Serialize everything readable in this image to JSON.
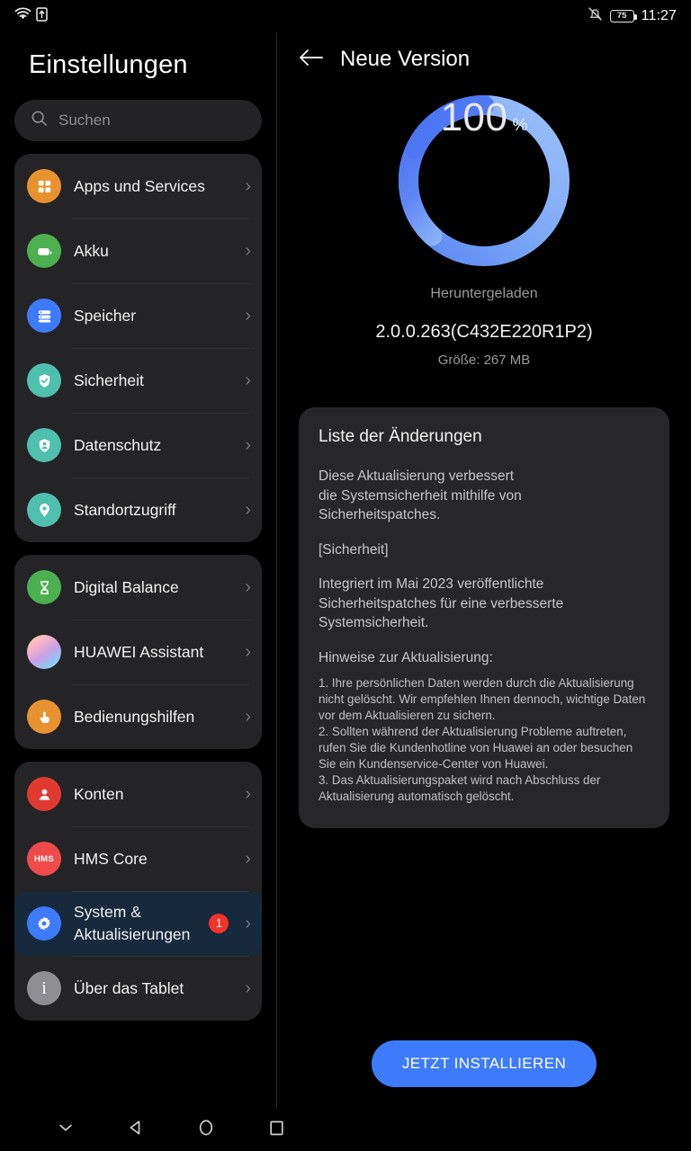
{
  "status_bar": {
    "wifi_icon": "wifi-icon",
    "vpn_icon": "vpn-upload-icon",
    "silent_icon": "bell-muted-icon",
    "battery_level": "75",
    "time": "11:27"
  },
  "sidebar": {
    "title": "Einstellungen",
    "search": {
      "placeholder": "Suchen",
      "icon": "search-icon"
    },
    "groups": [
      {
        "items": [
          {
            "label": "Apps und Services",
            "icon": "apps-grid-icon",
            "color": "#e8922f"
          },
          {
            "label": "Akku",
            "icon": "battery-icon",
            "color": "#4caf50"
          },
          {
            "label": "Speicher",
            "icon": "storage-stack-icon",
            "color": "#3d7bfb"
          },
          {
            "label": "Sicherheit",
            "icon": "shield-check-icon",
            "color": "#4fbfae"
          },
          {
            "label": "Datenschutz",
            "icon": "shield-person-icon",
            "color": "#4fbfae"
          },
          {
            "label": "Standortzugriff",
            "icon": "location-pin-icon",
            "color": "#4fbfae"
          }
        ]
      },
      {
        "items": [
          {
            "label": "Digital Balance",
            "icon": "hourglass-icon",
            "color": "#4caf50"
          },
          {
            "label": "HUAWEI Assistant",
            "icon": "assistant-orb-icon",
            "color": "#c9a0dc"
          },
          {
            "label": "Bedienungshilfen",
            "icon": "accessibility-tap-icon",
            "color": "#e8922f"
          }
        ]
      },
      {
        "items": [
          {
            "label": "Konten",
            "icon": "person-icon",
            "color": "#e0392f"
          },
          {
            "label": "HMS Core",
            "icon": "hms-icon",
            "color": "#ef4b4b"
          },
          {
            "label": "System & Aktualisierungen",
            "icon": "gear-icon",
            "color": "#3d7bfb",
            "badge": "1",
            "selected": true
          },
          {
            "label": "Über das Tablet",
            "icon": "info-icon",
            "color": "#8e8e93"
          }
        ]
      }
    ]
  },
  "main": {
    "back_icon": "back-arrow-icon",
    "title": "Neue Version",
    "progress": {
      "percent_value": "100",
      "percent_symbol": "%",
      "status": "Heruntergeladen",
      "ring_color_start": "#4a74f2",
      "ring_color_end": "#8ab4f8"
    },
    "version": "2.0.0.263(C432E220R1P2)",
    "size": "Größe: 267 MB",
    "changelog": {
      "title": "Liste der Änderungen",
      "paragraph_1": "Diese Aktualisierung verbessert\ndie Systemsicherheit mithilfe von\nSicherheitspatches.",
      "paragraph_2": "[Sicherheit]",
      "paragraph_3": "Integriert im Mai 2023 veröffentlichte\nSicherheitspatches für eine verbesserte\nSystemsicherheit.",
      "paragraph_4": "Hinweise zur Aktualisierung:",
      "notes": "1. Ihre persönlichen Daten werden durch die Aktualisierung nicht gelöscht. Wir empfehlen Ihnen dennoch, wichtige Daten vor dem Aktualisieren zu sichern.\n2. Sollten während der Aktualisierung Probleme auftreten, rufen Sie die Kundenhotline von Huawei an oder besuchen Sie ein Kundenservice-Center von Huawei.\n3. Das Aktualisierungspaket wird nach Abschluss der Aktualisierung automatisch gelöscht."
    },
    "install_button": "JETZT INSTALLIEREN"
  },
  "navbar": {
    "items": [
      {
        "icon": "chevron-down-icon",
        "name": "hide-keyboard-button"
      },
      {
        "icon": "triangle-back-icon",
        "name": "back-button"
      },
      {
        "icon": "circle-home-icon",
        "name": "home-button"
      },
      {
        "icon": "square-recents-icon",
        "name": "recents-button"
      }
    ]
  }
}
